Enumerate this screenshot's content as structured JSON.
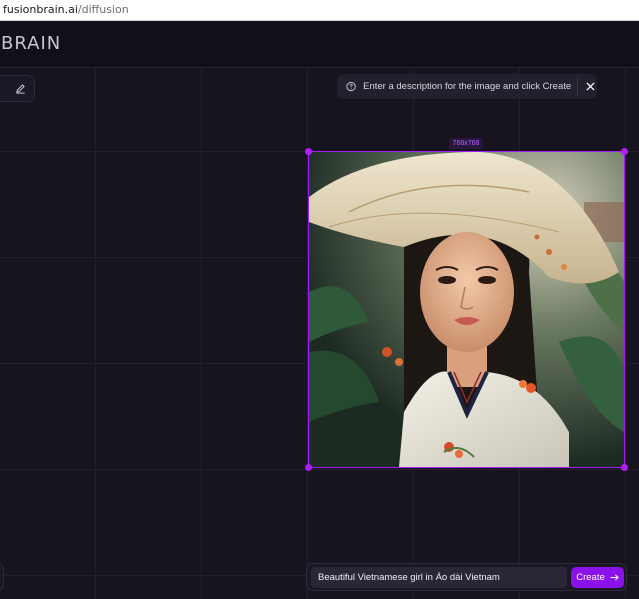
{
  "browser": {
    "url_domain": "fusionbrain.ai",
    "url_path": "/diffusion"
  },
  "header": {
    "logo_text": "BRAIN"
  },
  "toolbar": {
    "edit_icon": "pencil-icon"
  },
  "hint": {
    "icon": "question-circle-icon",
    "text": "Enter a description for the image and click Create",
    "close_icon": "close-icon"
  },
  "image_frame": {
    "size_label": "768x768"
  },
  "prompt": {
    "value": "Beautiful Vietnamese girl in Áo dài Vietnam",
    "create_label": "Create",
    "create_icon": "arrow-right-icon"
  },
  "colors": {
    "accent": "#8a12e8",
    "frame": "#a21bff",
    "background": "#17141f"
  }
}
